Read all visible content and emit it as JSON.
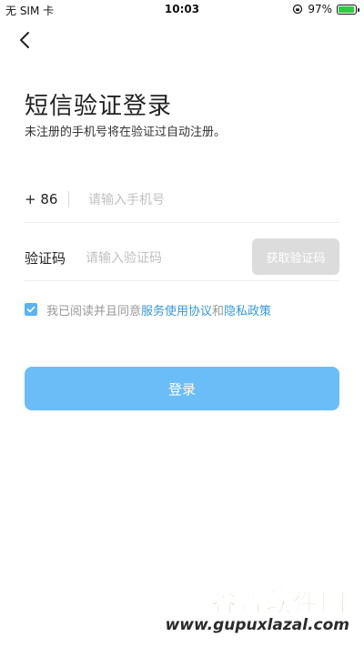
{
  "status_bar": {
    "carrier": "无 SIM 卡",
    "time": "10:03",
    "battery": "97%",
    "battery_level": 0.97
  },
  "header": {
    "title": "短信验证登录",
    "subtitle": "未注册的手机号将在验证过自动注册。"
  },
  "phone": {
    "country_code": "+ 86",
    "placeholder": "请输入手机号",
    "value": ""
  },
  "code": {
    "label": "验证码",
    "placeholder": "请输入验证码",
    "value": "",
    "get_code_label": "获取验证码"
  },
  "agreement": {
    "checked": true,
    "text_prefix": "我已阅读并且同意",
    "terms_link": "服务使用协议",
    "and": "和",
    "privacy_link": "隐私政策"
  },
  "login": {
    "label": "登录"
  },
  "watermark": {
    "title": "谷普软件园",
    "url": "www.gupuxlazal.com"
  },
  "colors": {
    "accent": "#6bbdf7",
    "link": "#3399dd",
    "disabled_button": "#dcdcdc"
  }
}
